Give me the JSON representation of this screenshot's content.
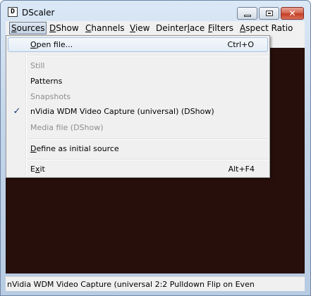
{
  "window": {
    "title": "DScaler",
    "icon_letter": "D",
    "controls": {
      "minimize": "minimize-icon",
      "maximize": "maximize-icon",
      "close": "✕"
    }
  },
  "menubar": {
    "items": [
      {
        "pre": "",
        "mn": "S",
        "post": "ources"
      },
      {
        "pre": "",
        "mn": "D",
        "post": "Show"
      },
      {
        "pre": "",
        "mn": "C",
        "post": "hannels"
      },
      {
        "pre": "",
        "mn": "V",
        "post": "iew"
      },
      {
        "pre": "Deinter",
        "mn": "l",
        "post": "ace"
      },
      {
        "pre": "",
        "mn": "F",
        "post": "ilters"
      },
      {
        "pre": "",
        "mn": "A",
        "post": "spect Ratio"
      }
    ]
  },
  "sources_menu": {
    "open_file": {
      "pre": "",
      "mn": "O",
      "post": "pen file...",
      "shortcut": "Ctrl+O"
    },
    "still": "Still",
    "patterns": "Patterns",
    "snapshots": "Snapshots",
    "nvidia": "nVidia WDM Video Capture (universal) (DShow)",
    "check": "✓",
    "media_file": "Media file (DShow)",
    "define": {
      "pre": "",
      "mn": "D",
      "post": "efine as initial source"
    },
    "exit": {
      "pre": "E",
      "mn": "x",
      "post": "it",
      "shortcut": "Alt+F4"
    }
  },
  "status": {
    "text": "nVidia WDM Video Capture (universal 2:2 Pulldown Flip on Even"
  },
  "colors": {
    "video_background": "#270f0c",
    "menu_background": "#f0f0f0",
    "highlight_border": "#a8c4e4",
    "disabled_text": "#8d8d8d"
  }
}
